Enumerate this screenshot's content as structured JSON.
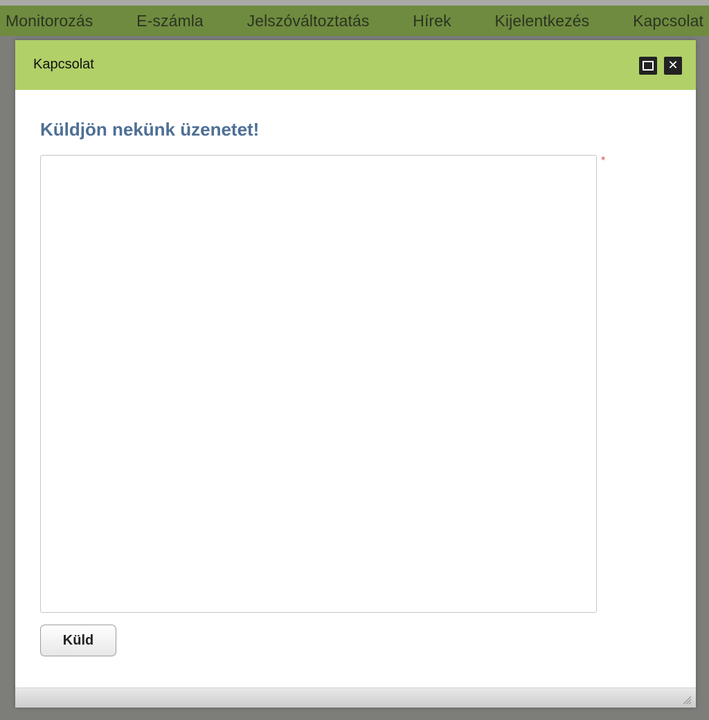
{
  "nav": {
    "items": [
      {
        "label": "Monitorozás"
      },
      {
        "label": "E-számla"
      },
      {
        "label": "Jelszóváltoztatás"
      },
      {
        "label": "Hírek"
      },
      {
        "label": "Kijelentkezés"
      },
      {
        "label": "Kapcsolat"
      }
    ]
  },
  "dialog": {
    "title": "Kapcsolat",
    "heading": "Küldjön nekünk üzenetet!",
    "message": {
      "value": "",
      "required_marker": "*"
    },
    "send_label": "Küld",
    "icons": {
      "maximize": "maximize-icon",
      "close": "close-icon",
      "resize": "resize-grip-icon"
    }
  },
  "colors": {
    "nav_bg": "#6f8b3f",
    "header_bg": "#b1d068",
    "heading": "#4e6f95",
    "required": "#d9534f"
  }
}
